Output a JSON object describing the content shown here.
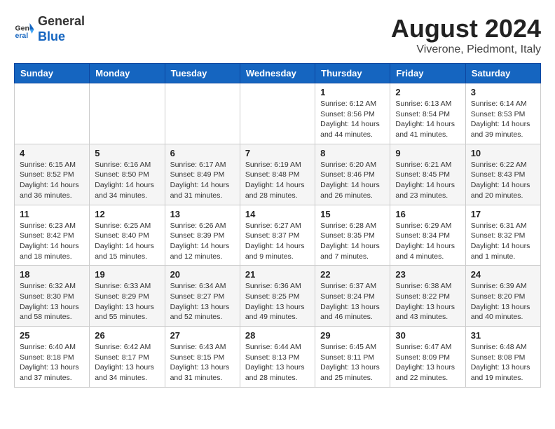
{
  "header": {
    "logo_line1": "General",
    "logo_line2": "Blue",
    "month_title": "August 2024",
    "location": "Viverone, Piedmont, Italy"
  },
  "weekdays": [
    "Sunday",
    "Monday",
    "Tuesday",
    "Wednesday",
    "Thursday",
    "Friday",
    "Saturday"
  ],
  "weeks": [
    [
      {
        "day": "",
        "info": ""
      },
      {
        "day": "",
        "info": ""
      },
      {
        "day": "",
        "info": ""
      },
      {
        "day": "",
        "info": ""
      },
      {
        "day": "1",
        "info": "Sunrise: 6:12 AM\nSunset: 8:56 PM\nDaylight: 14 hours and 44 minutes."
      },
      {
        "day": "2",
        "info": "Sunrise: 6:13 AM\nSunset: 8:54 PM\nDaylight: 14 hours and 41 minutes."
      },
      {
        "day": "3",
        "info": "Sunrise: 6:14 AM\nSunset: 8:53 PM\nDaylight: 14 hours and 39 minutes."
      }
    ],
    [
      {
        "day": "4",
        "info": "Sunrise: 6:15 AM\nSunset: 8:52 PM\nDaylight: 14 hours and 36 minutes."
      },
      {
        "day": "5",
        "info": "Sunrise: 6:16 AM\nSunset: 8:50 PM\nDaylight: 14 hours and 34 minutes."
      },
      {
        "day": "6",
        "info": "Sunrise: 6:17 AM\nSunset: 8:49 PM\nDaylight: 14 hours and 31 minutes."
      },
      {
        "day": "7",
        "info": "Sunrise: 6:19 AM\nSunset: 8:48 PM\nDaylight: 14 hours and 28 minutes."
      },
      {
        "day": "8",
        "info": "Sunrise: 6:20 AM\nSunset: 8:46 PM\nDaylight: 14 hours and 26 minutes."
      },
      {
        "day": "9",
        "info": "Sunrise: 6:21 AM\nSunset: 8:45 PM\nDaylight: 14 hours and 23 minutes."
      },
      {
        "day": "10",
        "info": "Sunrise: 6:22 AM\nSunset: 8:43 PM\nDaylight: 14 hours and 20 minutes."
      }
    ],
    [
      {
        "day": "11",
        "info": "Sunrise: 6:23 AM\nSunset: 8:42 PM\nDaylight: 14 hours and 18 minutes."
      },
      {
        "day": "12",
        "info": "Sunrise: 6:25 AM\nSunset: 8:40 PM\nDaylight: 14 hours and 15 minutes."
      },
      {
        "day": "13",
        "info": "Sunrise: 6:26 AM\nSunset: 8:39 PM\nDaylight: 14 hours and 12 minutes."
      },
      {
        "day": "14",
        "info": "Sunrise: 6:27 AM\nSunset: 8:37 PM\nDaylight: 14 hours and 9 minutes."
      },
      {
        "day": "15",
        "info": "Sunrise: 6:28 AM\nSunset: 8:35 PM\nDaylight: 14 hours and 7 minutes."
      },
      {
        "day": "16",
        "info": "Sunrise: 6:29 AM\nSunset: 8:34 PM\nDaylight: 14 hours and 4 minutes."
      },
      {
        "day": "17",
        "info": "Sunrise: 6:31 AM\nSunset: 8:32 PM\nDaylight: 14 hours and 1 minute."
      }
    ],
    [
      {
        "day": "18",
        "info": "Sunrise: 6:32 AM\nSunset: 8:30 PM\nDaylight: 13 hours and 58 minutes."
      },
      {
        "day": "19",
        "info": "Sunrise: 6:33 AM\nSunset: 8:29 PM\nDaylight: 13 hours and 55 minutes."
      },
      {
        "day": "20",
        "info": "Sunrise: 6:34 AM\nSunset: 8:27 PM\nDaylight: 13 hours and 52 minutes."
      },
      {
        "day": "21",
        "info": "Sunrise: 6:36 AM\nSunset: 8:25 PM\nDaylight: 13 hours and 49 minutes."
      },
      {
        "day": "22",
        "info": "Sunrise: 6:37 AM\nSunset: 8:24 PM\nDaylight: 13 hours and 46 minutes."
      },
      {
        "day": "23",
        "info": "Sunrise: 6:38 AM\nSunset: 8:22 PM\nDaylight: 13 hours and 43 minutes."
      },
      {
        "day": "24",
        "info": "Sunrise: 6:39 AM\nSunset: 8:20 PM\nDaylight: 13 hours and 40 minutes."
      }
    ],
    [
      {
        "day": "25",
        "info": "Sunrise: 6:40 AM\nSunset: 8:18 PM\nDaylight: 13 hours and 37 minutes."
      },
      {
        "day": "26",
        "info": "Sunrise: 6:42 AM\nSunset: 8:17 PM\nDaylight: 13 hours and 34 minutes."
      },
      {
        "day": "27",
        "info": "Sunrise: 6:43 AM\nSunset: 8:15 PM\nDaylight: 13 hours and 31 minutes."
      },
      {
        "day": "28",
        "info": "Sunrise: 6:44 AM\nSunset: 8:13 PM\nDaylight: 13 hours and 28 minutes."
      },
      {
        "day": "29",
        "info": "Sunrise: 6:45 AM\nSunset: 8:11 PM\nDaylight: 13 hours and 25 minutes."
      },
      {
        "day": "30",
        "info": "Sunrise: 6:47 AM\nSunset: 8:09 PM\nDaylight: 13 hours and 22 minutes."
      },
      {
        "day": "31",
        "info": "Sunrise: 6:48 AM\nSunset: 8:08 PM\nDaylight: 13 hours and 19 minutes."
      }
    ]
  ]
}
